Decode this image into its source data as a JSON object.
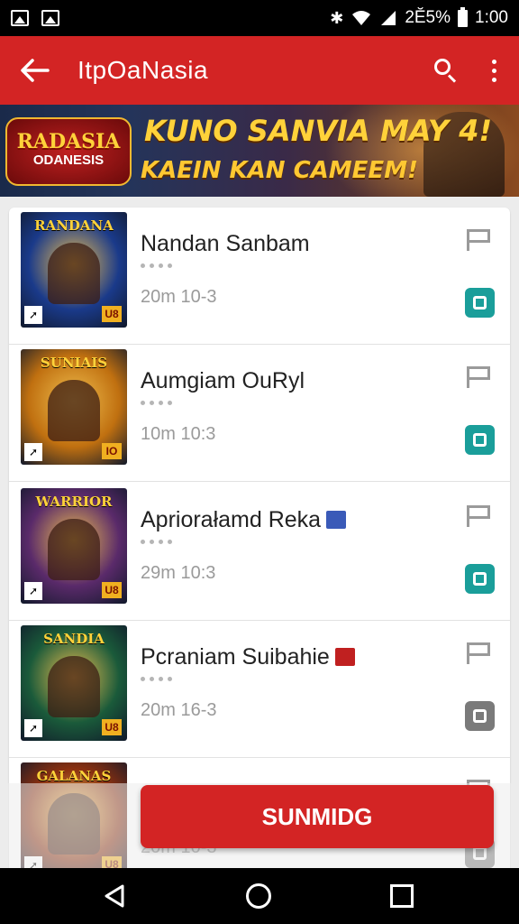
{
  "status_bar": {
    "percent": "2Ӗ5%",
    "time": "1:00",
    "icons": [
      "image-icon",
      "gallery-icon",
      "bluetooth-icon",
      "wifi-icon",
      "signal-icon",
      "battery-icon"
    ]
  },
  "app_bar": {
    "title": "ItpOaNasia",
    "icons": [
      "back-arrow-icon",
      "search-icon",
      "more-vert-icon"
    ]
  },
  "banner": {
    "logo_text": "RADASIA",
    "logo_sub": "ODANESIS",
    "headline": "KUNO SANVIA MAY 4!",
    "subline": "KAEIN KAN CAMEEM!"
  },
  "list": {
    "items": [
      {
        "title": "Nandan Sanbam",
        "meta": "20m 10-3",
        "thumb_title": "RANDANA",
        "badge": "U8",
        "action_color": "#1a9e9a",
        "thumb_bg": "#1a3a8a",
        "flag_color": ""
      },
      {
        "title": "Aumgiam OuRyl",
        "meta": "10m 10:3",
        "thumb_title": "SUNIAIS",
        "badge": "IO",
        "action_color": "#1a9e9a",
        "thumb_bg": "#c07010",
        "flag_color": ""
      },
      {
        "title": "Apriorałamd Reka",
        "meta": "29m 10:3",
        "thumb_title": "WARRIOR",
        "badge": "U8",
        "action_color": "#1a9e9a",
        "thumb_bg": "#5a2a6a",
        "flag_color": "#3a5ab8"
      },
      {
        "title": "Pcraniam Suibahie",
        "meta": "20m 16-3",
        "thumb_title": "SANDIA",
        "badge": "U8",
        "action_color": "#7a7a7a",
        "thumb_bg": "#1a5a3a",
        "flag_color": "#c02020"
      },
      {
        "title": "",
        "meta": "20m 10-3",
        "thumb_title": "GALANAS",
        "badge": "U8",
        "action_color": "#7a7a7a",
        "thumb_bg": "#8a3010",
        "flag_color": ""
      }
    ]
  },
  "primary_button": {
    "label": "SUNMIDG"
  },
  "nav_bar": {
    "icons": [
      "back-triangle-icon",
      "home-circle-icon",
      "recents-square-icon"
    ]
  },
  "colors": {
    "app_red": "#d32424",
    "teal": "#1a9e9a",
    "grey": "#7a7a7a"
  }
}
